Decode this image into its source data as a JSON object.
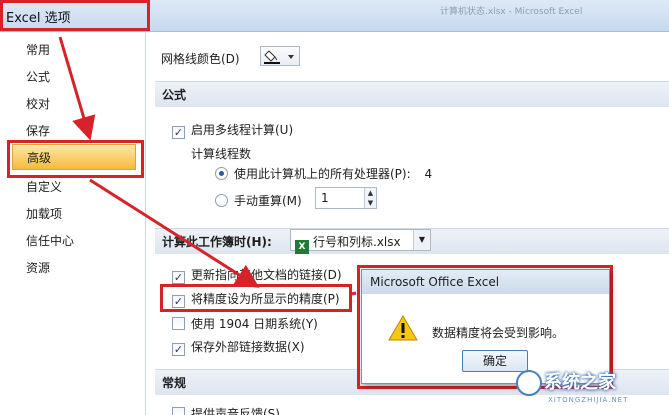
{
  "window": {
    "title": "Excel 选项",
    "title_right_blurred": "计算机状态.xlsx - Microsoft Excel"
  },
  "sidebar": {
    "items": [
      {
        "label": "常用"
      },
      {
        "label": "公式"
      },
      {
        "label": "校对"
      },
      {
        "label": "保存"
      },
      {
        "label": "高级",
        "selected": true
      },
      {
        "label": "自定义"
      },
      {
        "label": "加载项"
      },
      {
        "label": "信任中心"
      },
      {
        "label": "资源"
      }
    ]
  },
  "main": {
    "gridline_color_label": "网格线颜色(D)",
    "sections": {
      "formulas": "公式",
      "general": "常规"
    },
    "formulas": {
      "multithread_label": "启用多线程计算(U)",
      "multithread_checked": true,
      "threads_label": "计算线程数",
      "use_all_processors_label": "使用此计算机上的所有处理器(P):",
      "processor_count": "4",
      "use_all_processors_selected": true,
      "manual_label": "手动重算(M)",
      "manual_value": "1"
    },
    "workbook_calc": {
      "label": "计算此工作簿时(H):",
      "selected_file": "行号和列标.xlsx"
    },
    "options": [
      {
        "label": "更新指向其他文档的链接(D)",
        "checked": true
      },
      {
        "label": "将精度设为所显示的精度(P)",
        "checked": true
      },
      {
        "label": "使用 1904 日期系统(Y)",
        "checked": false
      },
      {
        "label": "保存外部链接数据(X)",
        "checked": true
      }
    ],
    "general_first_option": "提供声音反馈(S)"
  },
  "dialog": {
    "title": "Microsoft Office Excel",
    "message": "数据精度将会受到影响。",
    "ok_label": "确定"
  },
  "watermark": {
    "text": "系统之家",
    "sub": "XITONGZHIJIA.NET"
  },
  "colors": {
    "annotation_red": "#d6232a",
    "selected_orange": "#f7b93c",
    "checkbox_tick": "#2a3d5a"
  }
}
